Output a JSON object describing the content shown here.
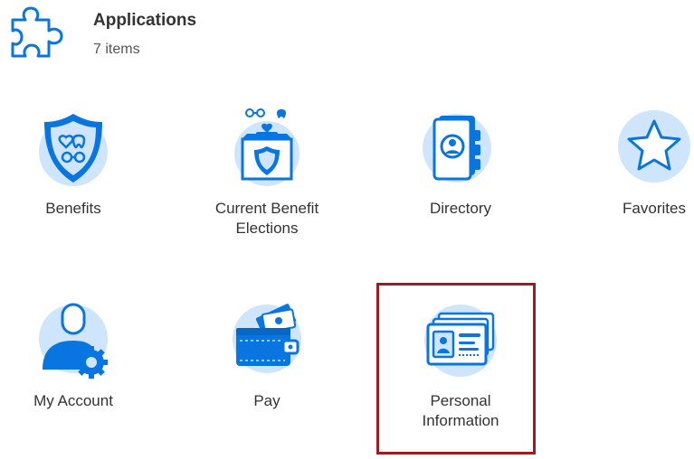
{
  "header": {
    "title": "Applications",
    "count": "7 items",
    "icon": "puzzle-icon"
  },
  "colors": {
    "icon_blue": "#0875e1",
    "icon_light": "#cfe5fb",
    "selection_border": "#9e1b1e"
  },
  "apps": [
    {
      "label": "Benefits",
      "icon": "shield-icon",
      "selected": false
    },
    {
      "label": "Current Benefit Elections",
      "icon": "benefit-box-icon",
      "selected": false
    },
    {
      "label": "Directory",
      "icon": "directory-book-icon",
      "selected": false
    },
    {
      "label": "Favorites",
      "icon": "star-icon",
      "selected": false
    },
    {
      "label": "My Account",
      "icon": "user-gear-icon",
      "selected": false
    },
    {
      "label": "Pay",
      "icon": "wallet-icon",
      "selected": false
    },
    {
      "label": "Personal Information",
      "icon": "id-card-icon",
      "selected": true
    }
  ]
}
